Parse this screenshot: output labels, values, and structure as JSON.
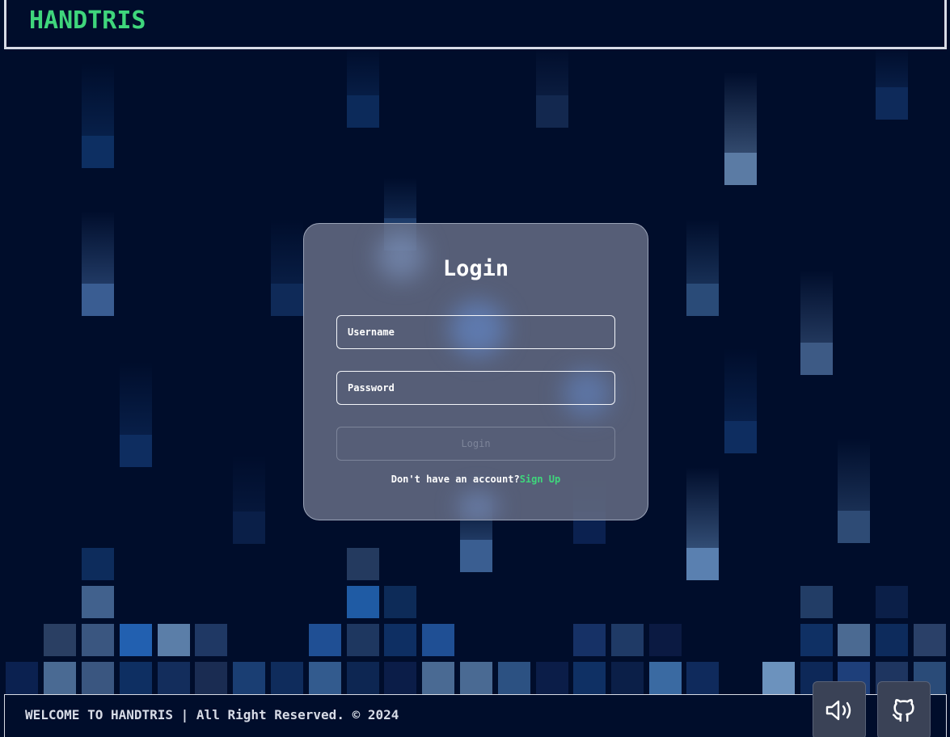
{
  "header": {
    "logo": "HANDTRIS"
  },
  "login": {
    "title": "Login",
    "username_placeholder": "Username",
    "password_placeholder": "Password",
    "button_label": "Login",
    "signup_prompt": "Don't have an account?",
    "signup_link": "Sign Up"
  },
  "footer": {
    "text": "WELCOME TO HANDTRIS | All Right Reserved. © 2024",
    "sound_icon": "speaker-icon",
    "github_icon": "github-icon"
  },
  "colors": {
    "background": "#000d2b",
    "accent": "#3fd67c",
    "border": "#d7dbe6"
  }
}
